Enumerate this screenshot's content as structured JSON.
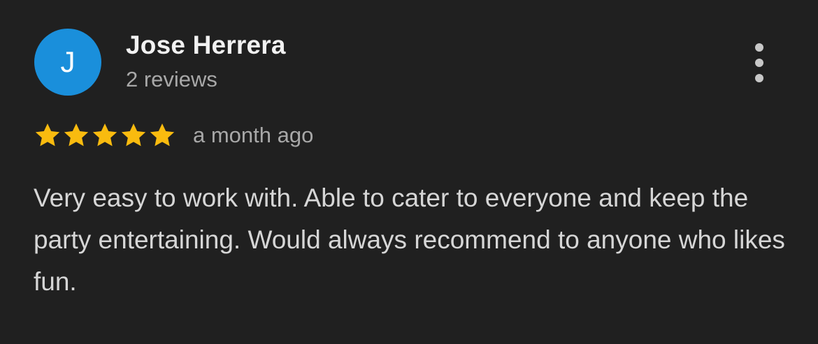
{
  "review": {
    "avatar_initial": "J",
    "author_name": "Jose Herrera",
    "review_count": "2 reviews",
    "rating": 5,
    "rating_max": 5,
    "date": "a month ago",
    "text": "Very easy to work with. Able to cater to everyone and keep the party entertaining. Would always recommend to anyone who likes fun."
  },
  "icons": {
    "more": "more-vert-icon",
    "star": "star-icon"
  },
  "colors": {
    "background": "#202020",
    "avatar": "#1a8fdb",
    "star": "#f9bb0f",
    "primary_text": "#f2f2f2",
    "secondary_text": "#a8a8a8"
  }
}
